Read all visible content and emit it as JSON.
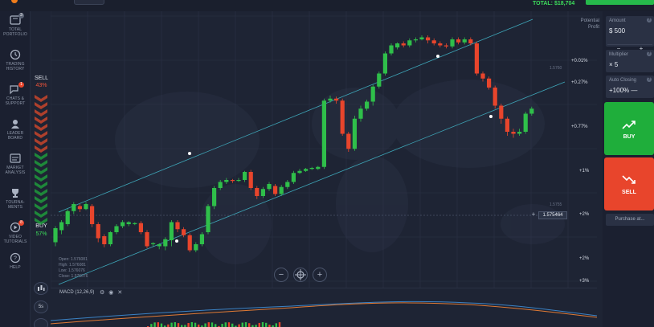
{
  "header": {
    "balance": "TOTAL: $18,704"
  },
  "sidebar": {
    "items": [
      {
        "label": "TOTAL\nPORTFOLIO",
        "icon": "portfolio-icon",
        "badge": "3"
      },
      {
        "label": "TRADING\nHISTORY",
        "icon": "history-icon"
      },
      {
        "label": "CHATS &\nSUPPORT",
        "icon": "chat-icon",
        "badge": "1"
      },
      {
        "label": "LEADER\nBOARD",
        "icon": "leaderboard-icon"
      },
      {
        "label": "MARKET\nANALYSIS",
        "icon": "market-analysis-icon"
      },
      {
        "label": "TOURNA-\nMENTS",
        "icon": "trophy-icon"
      },
      {
        "label": "VIDEO\nTUTORIALS",
        "icon": "video-icon",
        "badge": "8"
      },
      {
        "label": "HELP",
        "icon": "help-icon"
      }
    ]
  },
  "sentiment": {
    "sell_label": "SELL",
    "sell_pct": "43%",
    "buy_label": "BUY",
    "buy_pct": "57%",
    "sell_fraction": 0.43,
    "buy_fraction": 0.57
  },
  "chart": {
    "potential_profit_label": "Potential\nProfit",
    "scale_labels": [
      "+0.01%",
      "+0.27%",
      "+0.77%",
      "+1%",
      "+2%",
      "+2%",
      "+3%"
    ],
    "grey_prices": [
      "1.5760",
      "1.5755"
    ],
    "current_price": "1.575464",
    "ohlc": [
      "Open: 1.576081",
      "High: 1.576081",
      "Low: 1.576076",
      "Close: 1.576076"
    ],
    "zoom_out": "−",
    "zoom_in": "+",
    "candles": [
      {
        "o": 42,
        "c": 56,
        "h": 38,
        "l": 58
      },
      {
        "o": 54,
        "c": 62,
        "h": 50,
        "l": 64
      },
      {
        "o": 60,
        "c": 73,
        "h": 58,
        "l": 75
      },
      {
        "o": 73,
        "c": 80,
        "h": 70,
        "l": 82
      },
      {
        "o": 78,
        "c": 75,
        "h": 72,
        "l": 80
      },
      {
        "o": 75,
        "c": 80,
        "h": 74,
        "l": 82
      },
      {
        "o": 78,
        "c": 60,
        "h": 57,
        "l": 80
      },
      {
        "o": 60,
        "c": 46,
        "h": 42,
        "l": 62
      },
      {
        "o": 48,
        "c": 40,
        "h": 37,
        "l": 50
      },
      {
        "o": 40,
        "c": 52,
        "h": 38,
        "l": 53
      },
      {
        "o": 52,
        "c": 58,
        "h": 50,
        "l": 60
      },
      {
        "o": 58,
        "c": 62,
        "h": 56,
        "l": 64
      },
      {
        "o": 60,
        "c": 62,
        "h": 58,
        "l": 63
      },
      {
        "o": 60,
        "c": 61,
        "h": 59,
        "l": 62
      },
      {
        "o": 61,
        "c": 52,
        "h": 50,
        "l": 63
      },
      {
        "o": 52,
        "c": 38,
        "h": 36,
        "l": 54
      },
      {
        "o": 40,
        "c": 41,
        "h": 38,
        "l": 42
      },
      {
        "o": 38,
        "c": 40,
        "h": 35,
        "l": 41
      },
      {
        "o": 38,
        "c": 45,
        "h": 34,
        "l": 47
      },
      {
        "o": 44,
        "c": 62,
        "h": 38,
        "l": 64
      },
      {
        "o": 62,
        "c": 55,
        "h": 52,
        "l": 64
      },
      {
        "o": 55,
        "c": 49,
        "h": 47,
        "l": 57
      },
      {
        "o": 49,
        "c": 34,
        "h": 32,
        "l": 51
      },
      {
        "o": 34,
        "c": 40,
        "h": 32,
        "l": 42
      },
      {
        "o": 40,
        "c": 50,
        "h": 38,
        "l": 52
      },
      {
        "o": 52,
        "c": 78,
        "h": 50,
        "l": 80
      },
      {
        "o": 78,
        "c": 96,
        "h": 75,
        "l": 98
      },
      {
        "o": 96,
        "c": 102,
        "h": 94,
        "l": 104
      },
      {
        "o": 102,
        "c": 104,
        "h": 100,
        "l": 106
      },
      {
        "o": 104,
        "c": 103,
        "h": 101,
        "l": 105
      },
      {
        "o": 104,
        "c": 104,
        "h": 102,
        "l": 106
      },
      {
        "o": 104,
        "c": 112,
        "h": 102,
        "l": 113
      },
      {
        "o": 112,
        "c": 96,
        "h": 94,
        "l": 114
      },
      {
        "o": 96,
        "c": 88,
        "h": 85,
        "l": 98
      },
      {
        "o": 88,
        "c": 95,
        "h": 86,
        "l": 97
      },
      {
        "o": 95,
        "c": 100,
        "h": 93,
        "l": 102
      },
      {
        "o": 98,
        "c": 90,
        "h": 88,
        "l": 100
      },
      {
        "o": 90,
        "c": 97,
        "h": 88,
        "l": 99
      },
      {
        "o": 97,
        "c": 102,
        "h": 95,
        "l": 104
      },
      {
        "o": 102,
        "c": 111,
        "h": 100,
        "l": 113
      },
      {
        "o": 111,
        "c": 113,
        "h": 110,
        "l": 115
      },
      {
        "o": 113,
        "c": 115,
        "h": 112,
        "l": 116
      },
      {
        "o": 115,
        "c": 116,
        "h": 114,
        "l": 117
      },
      {
        "o": 115,
        "c": 117,
        "h": 114,
        "l": 118
      },
      {
        "o": 117,
        "c": 183,
        "h": 115,
        "l": 185
      },
      {
        "o": 183,
        "c": 185,
        "h": 181,
        "l": 188
      },
      {
        "o": 185,
        "c": 183,
        "h": 180,
        "l": 187
      },
      {
        "o": 183,
        "c": 150,
        "h": 148,
        "l": 185
      },
      {
        "o": 150,
        "c": 135,
        "h": 132,
        "l": 152
      },
      {
        "o": 135,
        "c": 165,
        "h": 133,
        "l": 168
      },
      {
        "o": 165,
        "c": 175,
        "h": 162,
        "l": 178
      },
      {
        "o": 175,
        "c": 182,
        "h": 173,
        "l": 184
      },
      {
        "o": 182,
        "c": 197,
        "h": 178,
        "l": 199
      },
      {
        "o": 197,
        "c": 210,
        "h": 195,
        "l": 212
      },
      {
        "o": 210,
        "c": 230,
        "h": 208,
        "l": 232
      },
      {
        "o": 230,
        "c": 238,
        "h": 228,
        "l": 240
      },
      {
        "o": 236,
        "c": 240,
        "h": 234,
        "l": 241
      },
      {
        "o": 240,
        "c": 238,
        "h": 236,
        "l": 242
      },
      {
        "o": 238,
        "c": 243,
        "h": 236,
        "l": 245
      },
      {
        "o": 243,
        "c": 244,
        "h": 241,
        "l": 246
      },
      {
        "o": 244,
        "c": 246,
        "h": 243,
        "l": 248
      },
      {
        "o": 246,
        "c": 243,
        "h": 240,
        "l": 248
      },
      {
        "o": 243,
        "c": 240,
        "h": 238,
        "l": 245
      },
      {
        "o": 240,
        "c": 238,
        "h": 236,
        "l": 242
      },
      {
        "o": 238,
        "c": 237,
        "h": 235,
        "l": 240
      },
      {
        "o": 237,
        "c": 244,
        "h": 235,
        "l": 246
      },
      {
        "o": 244,
        "c": 241,
        "h": 239,
        "l": 246
      },
      {
        "o": 241,
        "c": 244,
        "h": 239,
        "l": 246
      },
      {
        "o": 244,
        "c": 240,
        "h": 238,
        "l": 246
      },
      {
        "o": 240,
        "c": 210,
        "h": 208,
        "l": 242
      },
      {
        "o": 210,
        "c": 205,
        "h": 202,
        "l": 212
      },
      {
        "o": 205,
        "c": 196,
        "h": 194,
        "l": 207
      },
      {
        "o": 196,
        "c": 178,
        "h": 175,
        "l": 198
      },
      {
        "o": 178,
        "c": 165,
        "h": 160,
        "l": 180
      },
      {
        "o": 165,
        "c": 152,
        "h": 148,
        "l": 167
      },
      {
        "o": 152,
        "c": 150,
        "h": 146,
        "l": 155
      },
      {
        "o": 150,
        "c": 152,
        "h": 148,
        "l": 155
      },
      {
        "o": 152,
        "c": 170,
        "h": 150,
        "l": 172
      },
      {
        "o": 170,
        "c": 175,
        "h": 168,
        "l": 177
      }
    ]
  },
  "indicator": {
    "name": "MACD (12,26,9)",
    "icons": [
      "settings-icon",
      "eye-icon",
      "close-icon"
    ]
  },
  "tools": {
    "timeframe": "5s"
  },
  "right_panel": {
    "amount_label": "Amount",
    "amount_value": "$ 500",
    "minus": "−",
    "plus": "+",
    "multiplier_label": "Multiplier",
    "multiplier_value": "× 5",
    "auto_closing_label": "Auto Closing",
    "auto_closing_value": "+100% —",
    "buy_label": "BUY",
    "sell_label": "SELL",
    "purchase_label": "Purchase at...",
    "buy_color": "#1fae3b",
    "sell_color": "#e8452c"
  }
}
